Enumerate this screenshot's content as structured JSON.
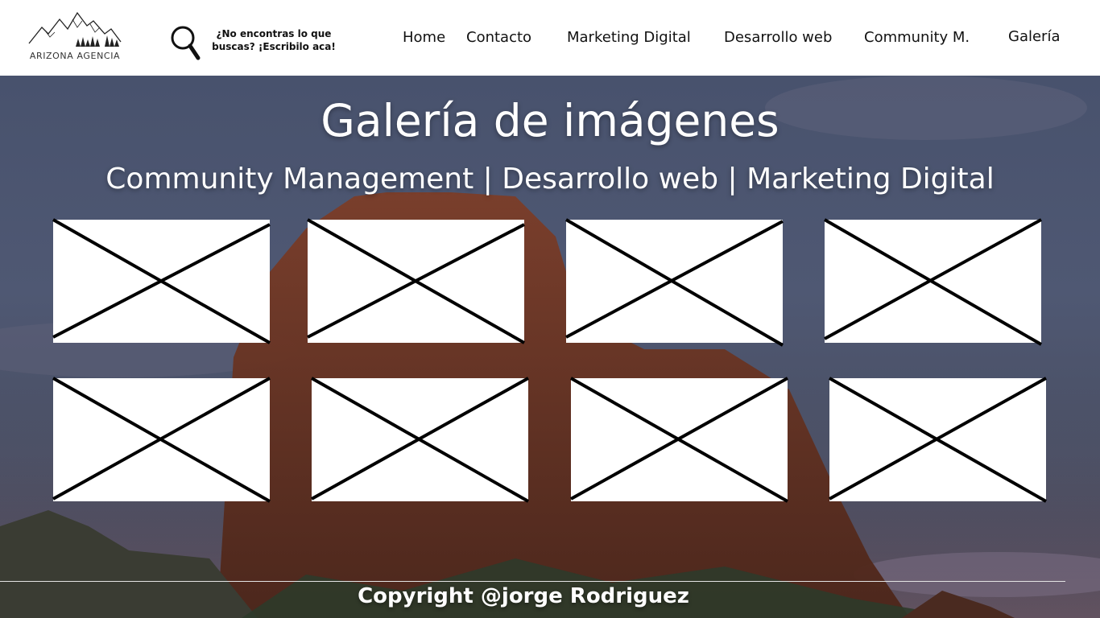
{
  "header": {
    "logo_text": "ARIZONA AGENCIA",
    "search": {
      "icon": "magnifier-icon",
      "prompt": "¿No encontras lo que buscas? ¡Escribilo aca!"
    },
    "nav": [
      {
        "label": "Home"
      },
      {
        "label": "Contacto"
      },
      {
        "label": "Marketing Digital"
      },
      {
        "label": "Desarrollo web"
      },
      {
        "label": "Community M."
      },
      {
        "label": "Galería"
      }
    ]
  },
  "hero": {
    "title": "Galería de imágenes",
    "subtitle": "Community Management | Desarrollo web | Marketing Digital"
  },
  "gallery": {
    "placeholder_icon": "image-placeholder-icon",
    "item_count": 8
  },
  "footer": {
    "copyright": "Copyright @jorge Rodriguez"
  },
  "colors": {
    "header_bg": "#ffffff",
    "text_dark": "#111111",
    "text_light": "#ffffff",
    "rock": "#7a3a26",
    "sky": "#4f5873"
  }
}
